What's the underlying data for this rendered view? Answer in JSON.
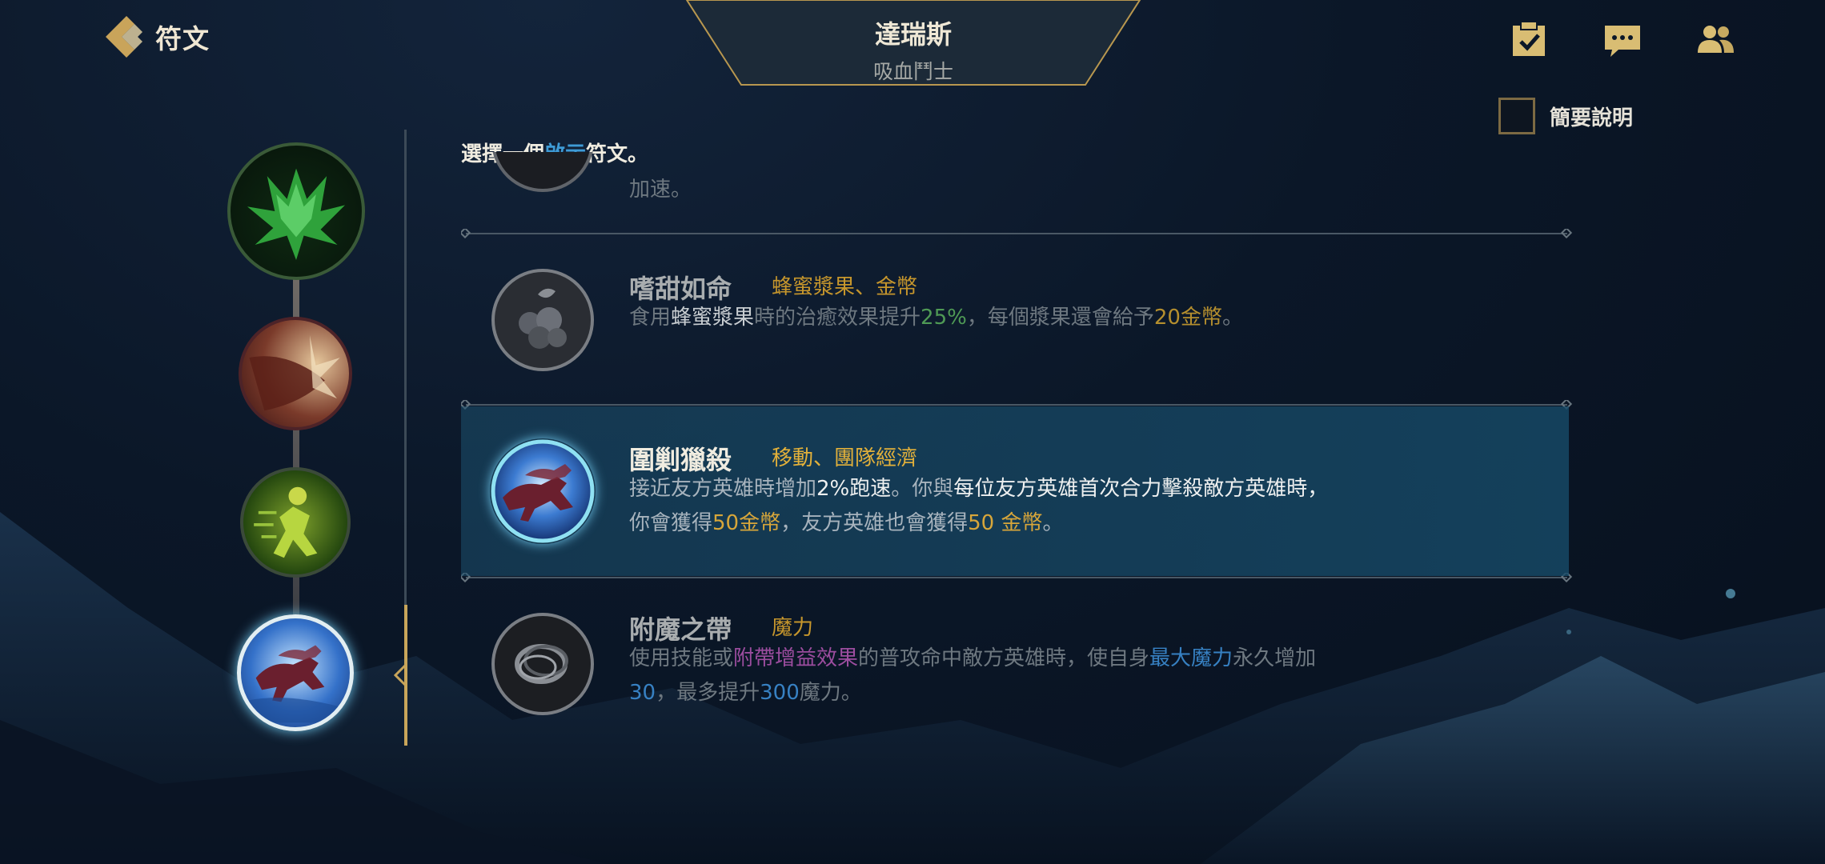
{
  "header": {
    "back_label": "符文",
    "champion_name": "達瑞斯",
    "champion_title": "吸血鬥士"
  },
  "top_icons": [
    "checklist-icon",
    "chat-icon",
    "friends-icon"
  ],
  "brief_toggle": {
    "label": "簡要說明",
    "checked": false
  },
  "prompt": {
    "before": "選擇一個",
    "highlight": "啟示",
    "after": "符文。"
  },
  "peek_text": "加速。",
  "runes": [
    {
      "name": "嗜甜如命",
      "tags": "蜂蜜漿果、金幣",
      "desc": [
        {
          "t": "食用",
          "c": ""
        },
        {
          "t": "蜂蜜漿果",
          "c": "w"
        },
        {
          "t": "時的治癒效果提升",
          "c": ""
        },
        {
          "t": "25%",
          "c": "g"
        },
        {
          "t": "，每個漿果還會給予",
          "c": ""
        },
        {
          "t": "20金幣",
          "c": "y"
        },
        {
          "t": "。",
          "c": ""
        }
      ],
      "selected": false
    },
    {
      "name": "圍剿獵殺",
      "tags": "移動、團隊經濟",
      "desc": [
        {
          "t": "接近友方英雄時增加",
          "c": ""
        },
        {
          "t": "2%跑速",
          "c": "w"
        },
        {
          "t": "。你與",
          "c": ""
        },
        {
          "t": "每位友方英雄首次合力擊殺敵方英雄時，",
          "c": "w"
        },
        {
          "t": "\n",
          "c": ""
        },
        {
          "t": "你會獲得",
          "c": ""
        },
        {
          "t": "50金幣",
          "c": "y2"
        },
        {
          "t": "，友方英雄也會獲得",
          "c": ""
        },
        {
          "t": "50 金幣",
          "c": "y2"
        },
        {
          "t": "。",
          "c": ""
        }
      ],
      "selected": true
    },
    {
      "name": "附魔之帶",
      "tags": "魔力",
      "desc": [
        {
          "t": "使用技能或",
          "c": ""
        },
        {
          "t": "附帶增益效果",
          "c": "p"
        },
        {
          "t": "的普攻命中敵方英雄時，使自身",
          "c": ""
        },
        {
          "t": "最大魔力",
          "c": "b"
        },
        {
          "t": "永久增加",
          "c": ""
        },
        {
          "t": "\n",
          "c": ""
        },
        {
          "t": "30",
          "c": "b"
        },
        {
          "t": "，最多提升",
          "c": ""
        },
        {
          "t": "300",
          "c": "b"
        },
        {
          "t": "魔力。",
          "c": ""
        }
      ],
      "selected": false
    }
  ],
  "tree": [
    "precision-green-rune-icon",
    "domination-slash-rune-icon",
    "resolve-runner-rune-icon",
    "pack-hunt-wolves-rune-icon"
  ]
}
